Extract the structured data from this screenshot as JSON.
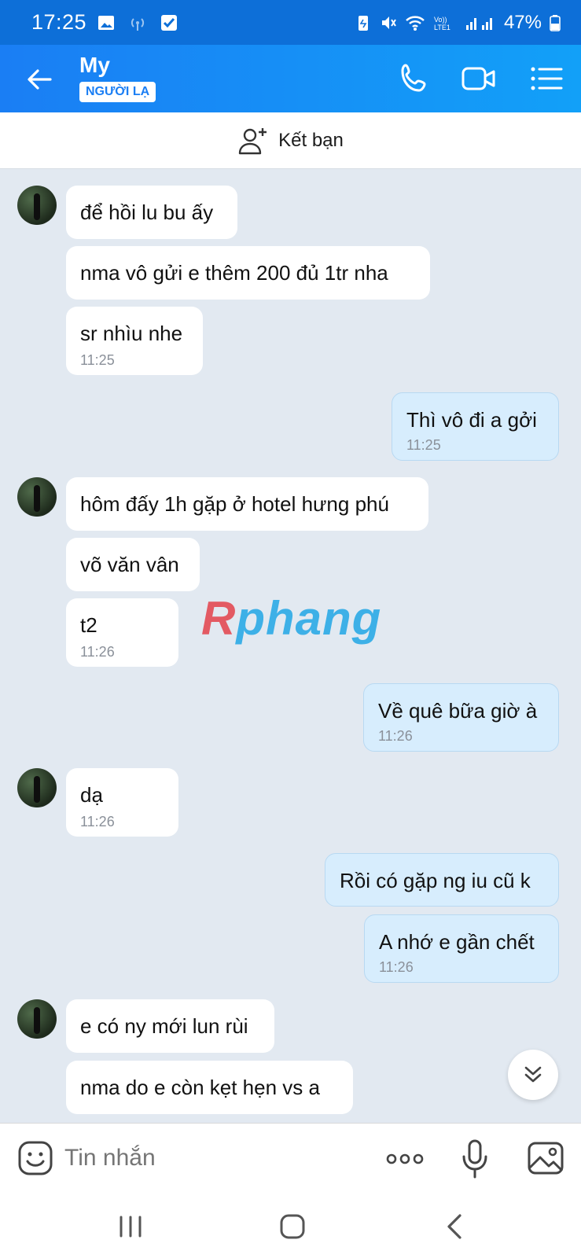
{
  "status_bar": {
    "time": "17:25",
    "battery": "47%",
    "icons": [
      "image-icon",
      "hotspot-icon",
      "check-icon",
      "battery-saver-icon",
      "mute-icon",
      "wifi-icon",
      "volte-icon",
      "signal-icon",
      "battery-icon"
    ]
  },
  "header": {
    "title": "My",
    "badge": "NGƯỜI LẠ",
    "accent": "#1a7ef4"
  },
  "friend_bar": {
    "label": "Kết bạn"
  },
  "messages": [
    {
      "side": "in",
      "text": "để hồi lu bu ấy"
    },
    {
      "side": "in",
      "text": "nma vô gửi e thêm 200 đủ 1tr nha"
    },
    {
      "side": "in",
      "text": "sr nhìu nhe",
      "time": "11:25"
    },
    {
      "side": "out",
      "text": "Thì vô đi a gởi",
      "time": "11:25"
    },
    {
      "side": "in",
      "text": "hôm đấy 1h gặp ở hotel hưng phú"
    },
    {
      "side": "in",
      "text": "võ văn vân"
    },
    {
      "side": "in",
      "text": "t2",
      "time": "11:26"
    },
    {
      "side": "out",
      "text": "Về quê bữa giờ à",
      "time": "11:26"
    },
    {
      "side": "in",
      "text": "dạ",
      "time": "11:26"
    },
    {
      "side": "out",
      "text": "Rồi có gặp ng iu cũ k"
    },
    {
      "side": "out",
      "text": "A nhớ e gần chết",
      "time": "11:26"
    },
    {
      "side": "in",
      "text": "e có ny mới lun rùi"
    },
    {
      "side": "in",
      "text": "nma do e còn kẹt hẹn vs a"
    }
  ],
  "watermark": {
    "part1": "R",
    "part2": "phang"
  },
  "composer": {
    "placeholder": "Tin nhắn"
  }
}
